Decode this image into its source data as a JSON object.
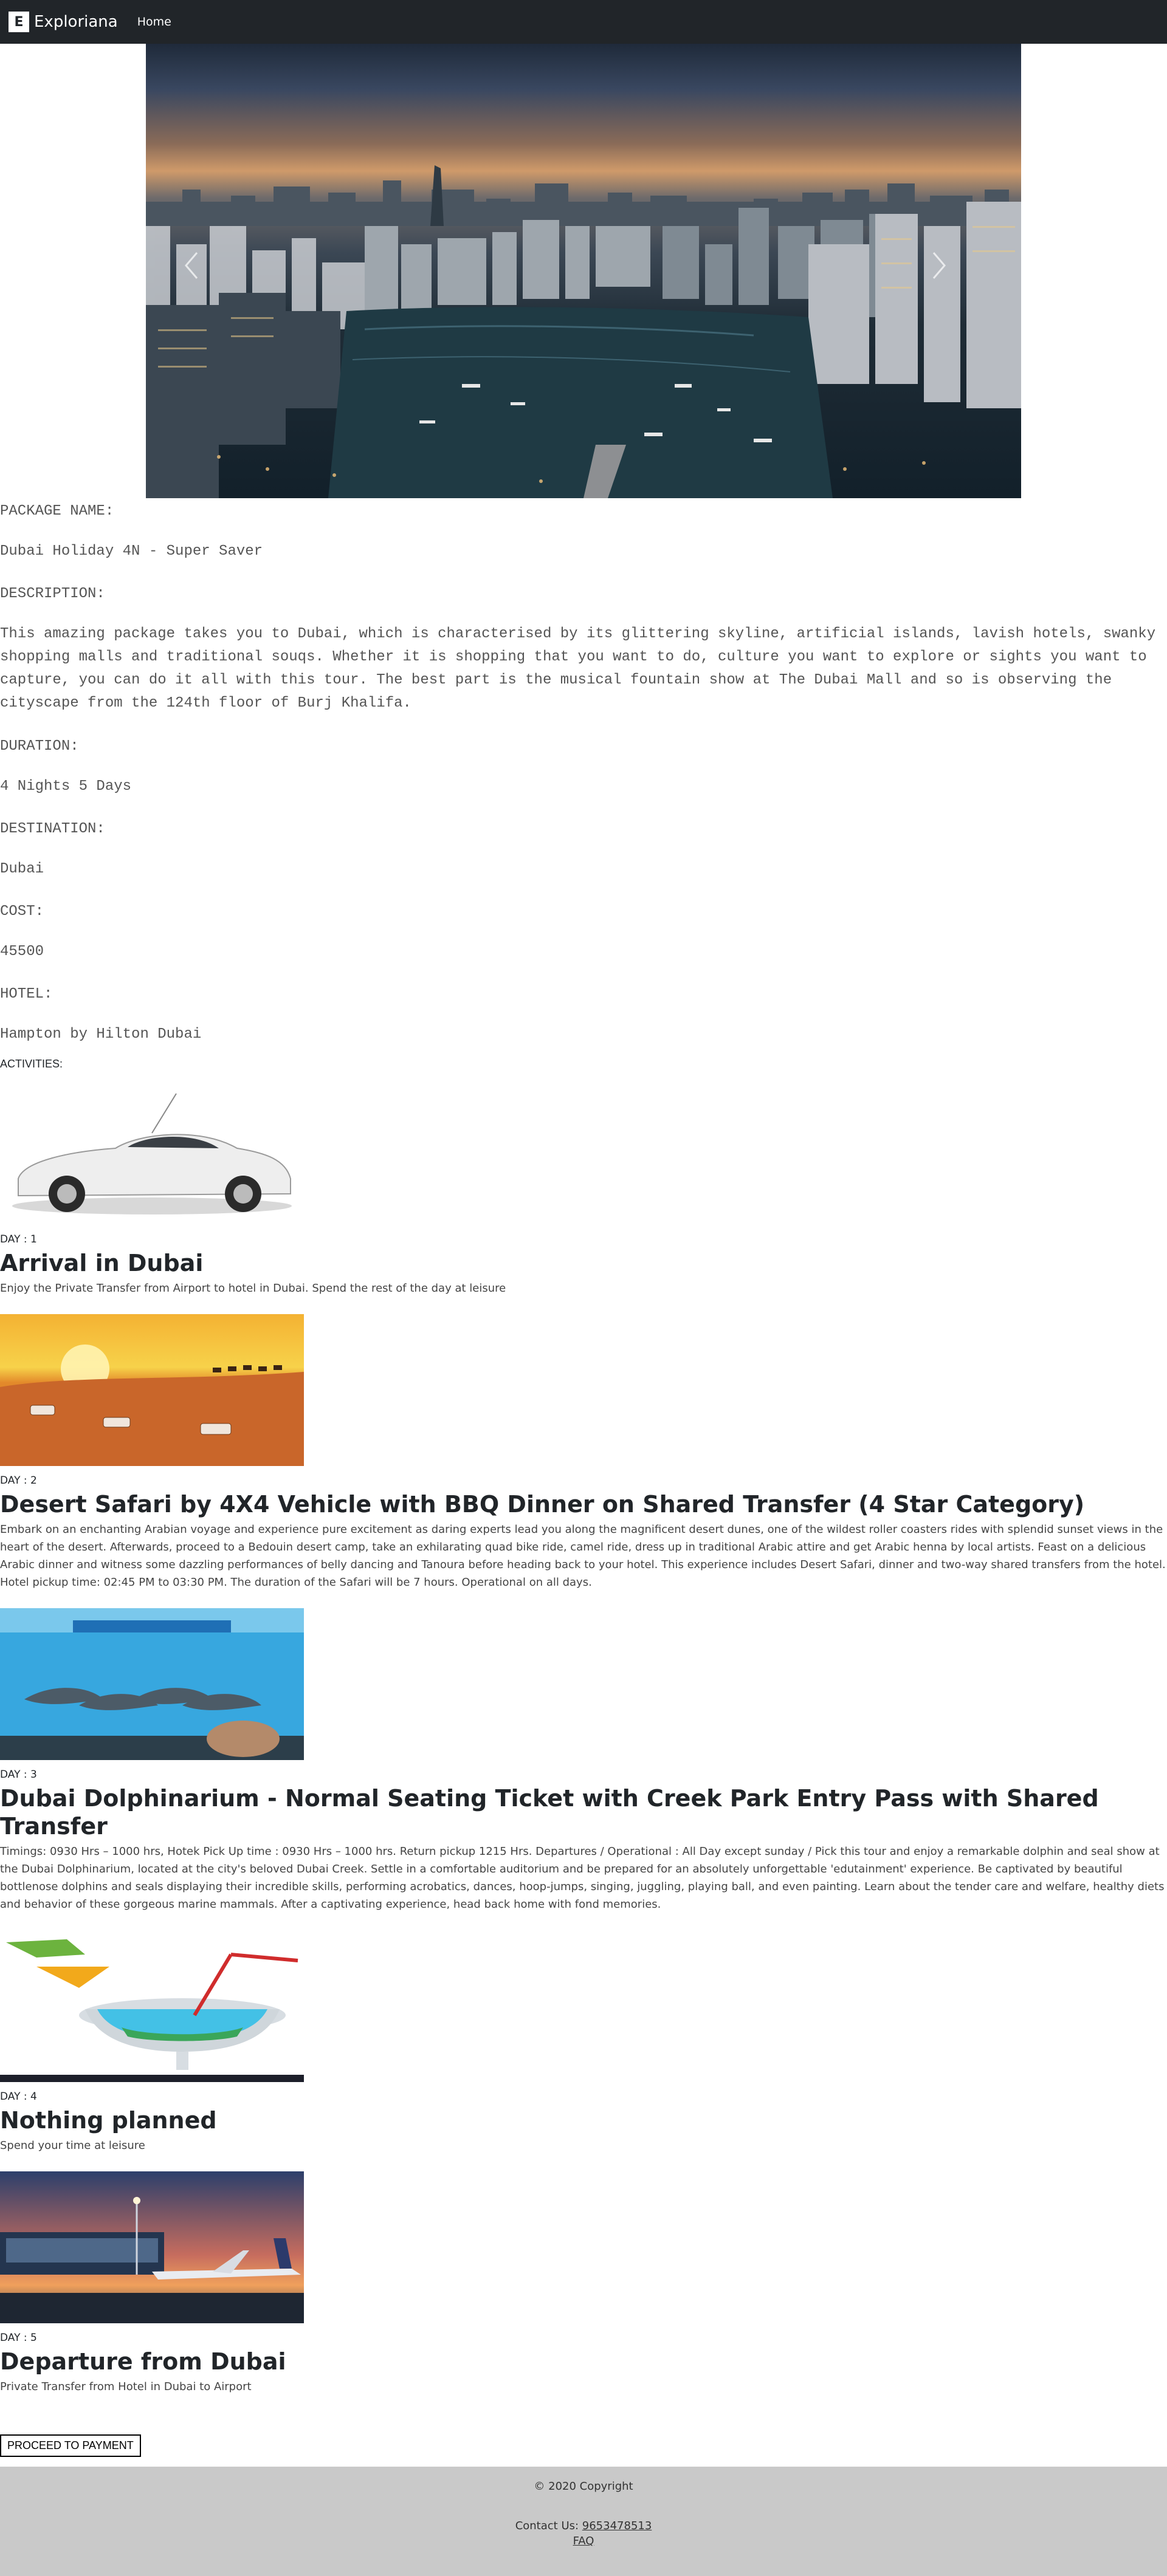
{
  "nav": {
    "brand": "Exploriana",
    "brand_logo": "E",
    "home": "Home"
  },
  "carousel": {
    "prev_icon": "chevron-left-icon",
    "next_icon": "chevron-right-icon"
  },
  "package": {
    "name_label": "PACKAGE NAME:",
    "name": "Dubai Holiday 4N - Super Saver",
    "description_label": "DESCRIPTION:",
    "description": "This amazing package takes you to Dubai, which is characterised by its glittering skyline, artificial islands, lavish hotels, swanky shopping malls and traditional souqs. Whether it is shopping that you want to do, culture you want to explore or sights you want to capture, you can do it all with this tour. The best part is the musical fountain show at The Dubai Mall and so is observing the cityscape from the 124th floor of Burj Khalifa.",
    "duration_label": "DURATION:",
    "duration": "4 Nights 5 Days",
    "destination_label": "DESTINATION:",
    "destination": "Dubai",
    "cost_label": "COST:",
    "cost": "45500",
    "hotel_label": "HOTEL:",
    "hotel": "Hampton by Hilton Dubai"
  },
  "activities_label": "ACTIVITIES:",
  "days": [
    {
      "day": "DAY : 1",
      "title": "Arrival in Dubai",
      "desc": "Enjoy the Private Transfer from Airport to hotel in Dubai. Spend the rest of the day at leisure"
    },
    {
      "day": "DAY : 2",
      "title": "Desert Safari by 4X4 Vehicle with BBQ Dinner on Shared Transfer (4 Star Category)",
      "desc": "Embark on an enchanting Arabian voyage and experience pure excitement as daring experts lead you along the magnificent desert dunes, one of the wildest roller coasters rides with splendid sunset views in the heart of the desert. Afterwards, proceed to a Bedouin desert camp, take an exhilarating quad bike ride, camel ride, dress up in traditional Arabic attire and get Arabic henna by local artists. Feast on a delicious Arabic dinner and witness some dazzling performances of belly dancing and Tanoura before heading back to your hotel. This experience includes Desert Safari, dinner and two-way shared transfers from the hotel. Hotel pickup time: 02:45 PM to 03:30 PM. The duration of the Safari will be 7 hours. Operational on all days."
    },
    {
      "day": "DAY : 3",
      "title": "Dubai Dolphinarium - Normal Seating Ticket with Creek Park Entry Pass with Shared Transfer",
      "desc": "Timings: 0930 Hrs – 1000 hrs, Hotek Pick Up time : 0930 Hrs – 1000 hrs. Return pickup 1215 Hrs. Departures / Operational : All Day except sunday / Pick this tour and enjoy a remarkable dolphin and seal show at the Dubai Dolphinarium, located at the city's beloved Dubai Creek. Settle in a comfortable auditorium and be prepared for an absolutely unforgettable 'edutainment' experience. Be captivated by beautiful bottlenose dolphins and seals displaying their incredible skills, performing acrobatics, dances, hoop-jumps, singing, juggling, playing ball, and even painting. Learn about the tender care and welfare, healthy diets and behavior of these gorgeous marine mammals. After a captivating experience, head back home with fond memories."
    },
    {
      "day": "DAY : 4",
      "title": "Nothing planned",
      "desc": "Spend your time at leisure"
    },
    {
      "day": "DAY : 5",
      "title": "Departure from Dubai",
      "desc": "Private Transfer from Hotel in Dubai to Airport"
    }
  ],
  "pay_button": "PROCEED TO PAYMENT",
  "footer": {
    "copyright": "© 2020 Copyright",
    "contact_label": "Contact Us: ",
    "phone": "9653478513",
    "faq": "FAQ"
  }
}
